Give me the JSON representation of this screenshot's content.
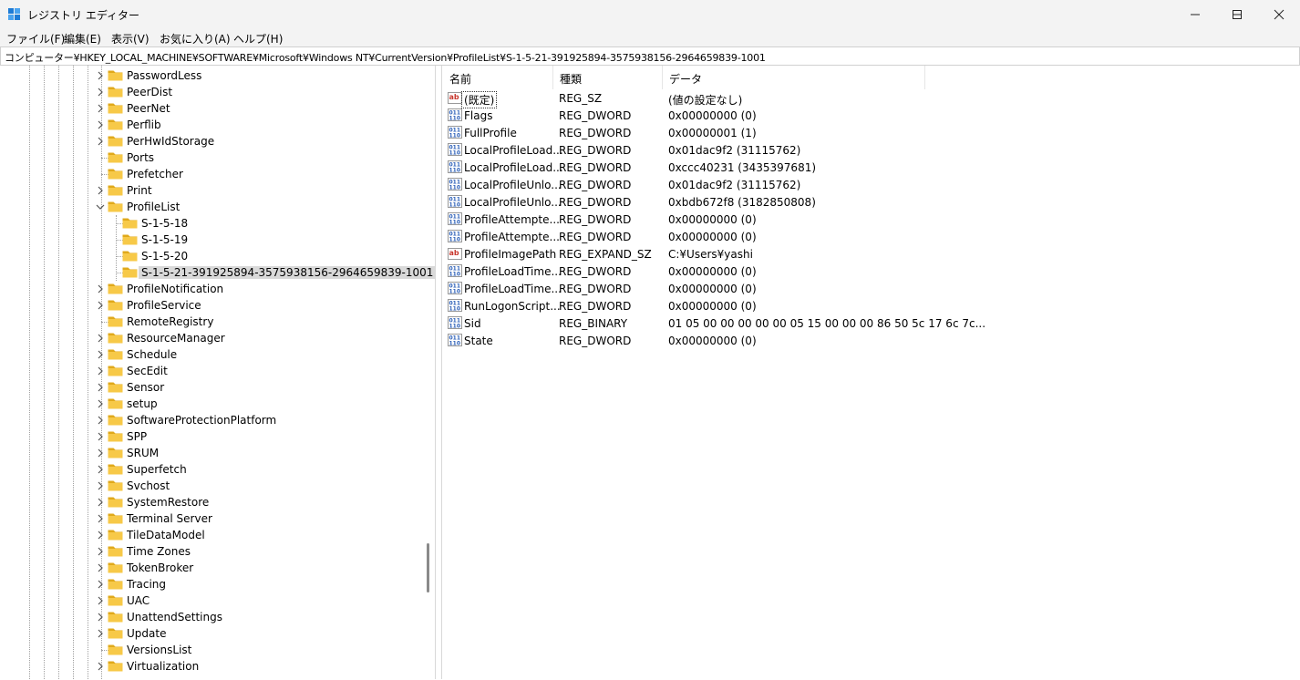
{
  "window": {
    "title": "レジストリ エディター"
  },
  "menu": [
    "ファイル(F)",
    "編集(E)",
    "表示(V)",
    "お気に入り(A)",
    "ヘルプ(H)"
  ],
  "address": "コンピューター¥HKEY_LOCAL_MACHINE¥SOFTWARE¥Microsoft¥Windows NT¥CurrentVersion¥ProfileList¥S-1-5-21-391925894-3575938156-2964659839-1001",
  "tree": [
    {
      "label": "PasswordLess",
      "level": 1,
      "expander": "collapsed"
    },
    {
      "label": "PeerDist",
      "level": 1,
      "expander": "collapsed"
    },
    {
      "label": "PeerNet",
      "level": 1,
      "expander": "collapsed"
    },
    {
      "label": "Perflib",
      "level": 1,
      "expander": "collapsed"
    },
    {
      "label": "PerHwIdStorage",
      "level": 1,
      "expander": "collapsed"
    },
    {
      "label": "Ports",
      "level": 1,
      "expander": "none"
    },
    {
      "label": "Prefetcher",
      "level": 1,
      "expander": "none"
    },
    {
      "label": "Print",
      "level": 1,
      "expander": "collapsed"
    },
    {
      "label": "ProfileList",
      "level": 1,
      "expander": "expanded"
    },
    {
      "label": "S-1-5-18",
      "level": 2,
      "expander": "none"
    },
    {
      "label": "S-1-5-19",
      "level": 2,
      "expander": "none"
    },
    {
      "label": "S-1-5-20",
      "level": 2,
      "expander": "none"
    },
    {
      "label": "S-1-5-21-391925894-3575938156-2964659839-1001",
      "level": 2,
      "expander": "none",
      "selected": true
    },
    {
      "label": "ProfileNotification",
      "level": 1,
      "expander": "collapsed"
    },
    {
      "label": "ProfileService",
      "level": 1,
      "expander": "collapsed"
    },
    {
      "label": "RemoteRegistry",
      "level": 1,
      "expander": "none"
    },
    {
      "label": "ResourceManager",
      "level": 1,
      "expander": "collapsed"
    },
    {
      "label": "Schedule",
      "level": 1,
      "expander": "collapsed"
    },
    {
      "label": "SecEdit",
      "level": 1,
      "expander": "collapsed"
    },
    {
      "label": "Sensor",
      "level": 1,
      "expander": "collapsed"
    },
    {
      "label": "setup",
      "level": 1,
      "expander": "collapsed"
    },
    {
      "label": "SoftwareProtectionPlatform",
      "level": 1,
      "expander": "collapsed"
    },
    {
      "label": "SPP",
      "level": 1,
      "expander": "collapsed"
    },
    {
      "label": "SRUM",
      "level": 1,
      "expander": "collapsed"
    },
    {
      "label": "Superfetch",
      "level": 1,
      "expander": "collapsed"
    },
    {
      "label": "Svchost",
      "level": 1,
      "expander": "collapsed"
    },
    {
      "label": "SystemRestore",
      "level": 1,
      "expander": "collapsed"
    },
    {
      "label": "Terminal Server",
      "level": 1,
      "expander": "collapsed"
    },
    {
      "label": "TileDataModel",
      "level": 1,
      "expander": "collapsed"
    },
    {
      "label": "Time Zones",
      "level": 1,
      "expander": "collapsed"
    },
    {
      "label": "TokenBroker",
      "level": 1,
      "expander": "collapsed"
    },
    {
      "label": "Tracing",
      "level": 1,
      "expander": "collapsed"
    },
    {
      "label": "UAC",
      "level": 1,
      "expander": "collapsed"
    },
    {
      "label": "UnattendSettings",
      "level": 1,
      "expander": "collapsed"
    },
    {
      "label": "Update",
      "level": 1,
      "expander": "collapsed"
    },
    {
      "label": "VersionsList",
      "level": 1,
      "expander": "none"
    },
    {
      "label": "Virtualization",
      "level": 1,
      "expander": "collapsed"
    }
  ],
  "columns": [
    "名前",
    "種類",
    "データ"
  ],
  "values": [
    {
      "icon": "string-value-icon",
      "name": "(既定)",
      "type": "REG_SZ",
      "data": "(値の設定なし)",
      "focus": true
    },
    {
      "icon": "binary-value-icon",
      "name": "Flags",
      "type": "REG_DWORD",
      "data": "0x00000000 (0)"
    },
    {
      "icon": "binary-value-icon",
      "name": "FullProfile",
      "type": "REG_DWORD",
      "data": "0x00000001 (1)"
    },
    {
      "icon": "binary-value-icon",
      "name": "LocalProfileLoad...",
      "type": "REG_DWORD",
      "data": "0x01dac9f2 (31115762)"
    },
    {
      "icon": "binary-value-icon",
      "name": "LocalProfileLoad...",
      "type": "REG_DWORD",
      "data": "0xccc40231 (3435397681)"
    },
    {
      "icon": "binary-value-icon",
      "name": "LocalProfileUnlo...",
      "type": "REG_DWORD",
      "data": "0x01dac9f2 (31115762)"
    },
    {
      "icon": "binary-value-icon",
      "name": "LocalProfileUnlo...",
      "type": "REG_DWORD",
      "data": "0xbdb672f8 (3182850808)"
    },
    {
      "icon": "binary-value-icon",
      "name": "ProfileAttempte...",
      "type": "REG_DWORD",
      "data": "0x00000000 (0)"
    },
    {
      "icon": "binary-value-icon",
      "name": "ProfileAttempte...",
      "type": "REG_DWORD",
      "data": "0x00000000 (0)"
    },
    {
      "icon": "string-value-icon",
      "name": "ProfileImagePath",
      "type": "REG_EXPAND_SZ",
      "data": "C:¥Users¥yashi"
    },
    {
      "icon": "binary-value-icon",
      "name": "ProfileLoadTime...",
      "type": "REG_DWORD",
      "data": "0x00000000 (0)"
    },
    {
      "icon": "binary-value-icon",
      "name": "ProfileLoadTime...",
      "type": "REG_DWORD",
      "data": "0x00000000 (0)"
    },
    {
      "icon": "binary-value-icon",
      "name": "RunLogonScript...",
      "type": "REG_DWORD",
      "data": "0x00000000 (0)"
    },
    {
      "icon": "binary-value-icon",
      "name": "Sid",
      "type": "REG_BINARY",
      "data": "01 05 00 00 00 00 00 05 15 00 00 00 86 50 5c 17 6c 7c..."
    },
    {
      "icon": "binary-value-icon",
      "name": "State",
      "type": "REG_DWORD",
      "data": "0x00000000 (0)"
    }
  ],
  "colors": {
    "folder": "#f7c948",
    "folder_dark": "#e0a91b",
    "selection": "#d9d9d9",
    "string_icon_red": "#c8372d",
    "binary_icon_blue": "#2b5fb8"
  }
}
